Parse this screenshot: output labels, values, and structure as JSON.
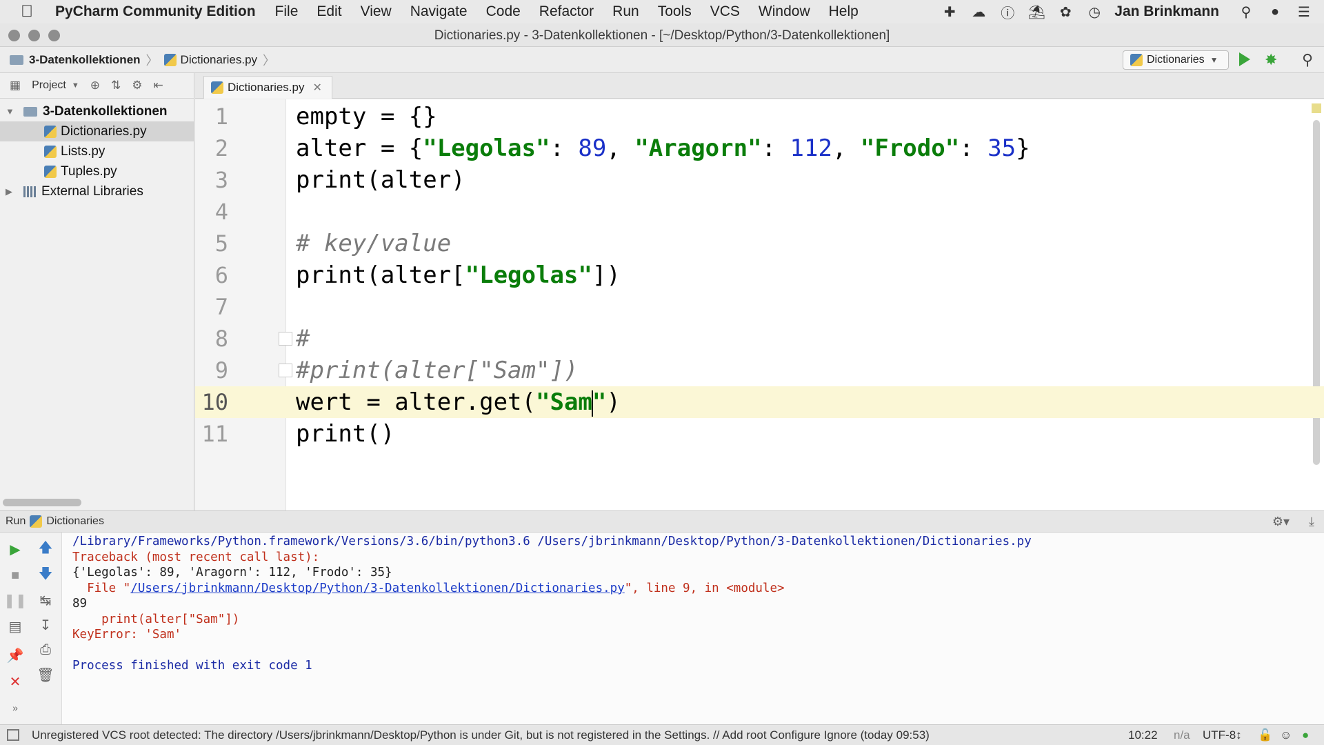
{
  "menubar": {
    "app_name": "PyCharm Community Edition",
    "items": [
      "File",
      "Edit",
      "View",
      "Navigate",
      "Code",
      "Refactor",
      "Run",
      "Tools",
      "VCS",
      "Window",
      "Help"
    ],
    "user": "Jan Brinkmann"
  },
  "window": {
    "title": "Dictionaries.py - 3-Datenkollektionen - [~/Desktop/Python/3-Datenkollektionen]"
  },
  "navbar": {
    "crumb_folder": "3-Datenkollektionen",
    "crumb_file": "Dictionaries.py",
    "run_config": "Dictionaries"
  },
  "project": {
    "label": "Project",
    "tree": [
      {
        "label": "3-Datenkollektionen",
        "level": 0,
        "type": "folder",
        "expanded": true
      },
      {
        "label": "Dictionaries.py",
        "level": 1,
        "type": "file",
        "selected": true
      },
      {
        "label": "Lists.py",
        "level": 1,
        "type": "file"
      },
      {
        "label": "Tuples.py",
        "level": 1,
        "type": "file"
      },
      {
        "label": "External Libraries",
        "level": 0,
        "type": "library",
        "expanded": false
      }
    ]
  },
  "editor": {
    "tab_label": "Dictionaries.py",
    "current_line": 10,
    "lines": [
      {
        "n": "1",
        "segments": [
          {
            "t": "empty = {}",
            "c": ""
          }
        ]
      },
      {
        "n": "2",
        "segments": [
          {
            "t": "alter = {",
            "c": ""
          },
          {
            "t": "\"Legolas\"",
            "c": "str"
          },
          {
            "t": ": ",
            "c": ""
          },
          {
            "t": "89",
            "c": "num"
          },
          {
            "t": ", ",
            "c": ""
          },
          {
            "t": "\"Aragorn\"",
            "c": "str"
          },
          {
            "t": ": ",
            "c": ""
          },
          {
            "t": "112",
            "c": "num"
          },
          {
            "t": ", ",
            "c": ""
          },
          {
            "t": "\"Frodo\"",
            "c": "str"
          },
          {
            "t": ": ",
            "c": ""
          },
          {
            "t": "35",
            "c": "num"
          },
          {
            "t": "}",
            "c": ""
          }
        ]
      },
      {
        "n": "3",
        "segments": [
          {
            "t": "print(alter)",
            "c": ""
          }
        ]
      },
      {
        "n": "4",
        "segments": []
      },
      {
        "n": "5",
        "segments": [
          {
            "t": "# key/value",
            "c": "com"
          }
        ]
      },
      {
        "n": "6",
        "segments": [
          {
            "t": "print(alter[",
            "c": ""
          },
          {
            "t": "\"Legolas\"",
            "c": "str"
          },
          {
            "t": "])",
            "c": ""
          }
        ]
      },
      {
        "n": "7",
        "segments": []
      },
      {
        "n": "8",
        "segments": [
          {
            "t": "#",
            "c": "com"
          }
        ]
      },
      {
        "n": "9",
        "segments": [
          {
            "t": "#print(alter[\"Sam\"])",
            "c": "com"
          }
        ]
      },
      {
        "n": "10",
        "segments": [
          {
            "t": "wert = alter.get(",
            "c": ""
          },
          {
            "t": "\"Sam",
            "c": "str"
          },
          {
            "t": "|",
            "c": "caret"
          },
          {
            "t": "\"",
            "c": "str"
          },
          {
            "t": ")",
            "c": ""
          }
        ]
      },
      {
        "n": "11",
        "segments": [
          {
            "t": "print()",
            "c": ""
          }
        ]
      }
    ]
  },
  "run_panel": {
    "label": "Run",
    "config": "Dictionaries",
    "console": [
      {
        "parts": [
          {
            "t": "/Library/Frameworks/Python.framework/Versions/3.6/bin/python3.6 /Users/jbrinkmann/Desktop/Python/3-Datenkollektionen/Dictionaries.py",
            "c": "path"
          }
        ]
      },
      {
        "parts": [
          {
            "t": "Traceback (most recent call last):",
            "c": "err"
          }
        ]
      },
      {
        "parts": [
          {
            "t": "{'Legolas': 89, 'Aragorn': 112, 'Frodo': 35}",
            "c": "out"
          }
        ]
      },
      {
        "parts": [
          {
            "t": "  File \"",
            "c": "err"
          },
          {
            "t": "/Users/jbrinkmann/Desktop/Python/3-Datenkollektionen/Dictionaries.py",
            "c": "link"
          },
          {
            "t": "\", line 9, in <module>",
            "c": "err"
          }
        ]
      },
      {
        "parts": [
          {
            "t": "89",
            "c": "out"
          }
        ]
      },
      {
        "parts": [
          {
            "t": "    print(alter[\"Sam\"])",
            "c": "err"
          }
        ]
      },
      {
        "parts": [
          {
            "t": "KeyError: 'Sam'",
            "c": "err"
          }
        ]
      },
      {
        "parts": [
          {
            "t": "",
            "c": "out"
          }
        ]
      },
      {
        "parts": [
          {
            "t": "Process finished with exit code 1",
            "c": "exit"
          }
        ]
      }
    ]
  },
  "statusbar": {
    "message": "Unregistered VCS root detected: The directory /Users/jbrinkmann/Desktop/Python is under Git, but is not registered in the Settings. // Add root  Configure  Ignore (today 09:53)",
    "position": "10:22",
    "na": "n/a",
    "encoding": "UTF-8↕"
  }
}
